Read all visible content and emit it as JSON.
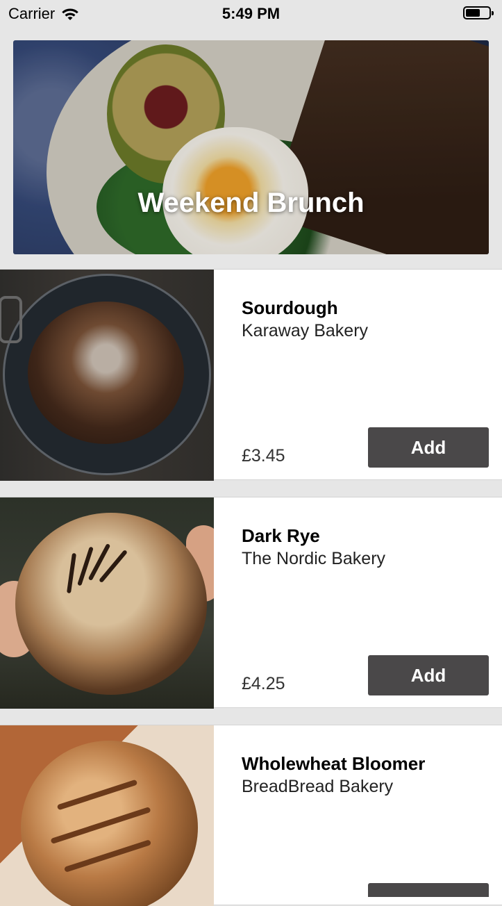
{
  "status_bar": {
    "carrier": "Carrier",
    "time": "5:49 PM"
  },
  "hero": {
    "title": "Weekend Brunch"
  },
  "products": [
    {
      "name": "Sourdough",
      "bakery": "Karaway Bakery",
      "price": "£3.45",
      "button": "Add"
    },
    {
      "name": "Dark Rye",
      "bakery": "The Nordic Bakery",
      "price": "£4.25",
      "button": "Add"
    },
    {
      "name": "Wholewheat Bloomer",
      "bakery": "BreadBread Bakery",
      "price": "",
      "button": ""
    }
  ],
  "colors": {
    "button_bg": "#4a4849",
    "page_bg": "#e6e6e6"
  },
  "icons": [
    "wifi-icon",
    "battery-icon"
  ]
}
